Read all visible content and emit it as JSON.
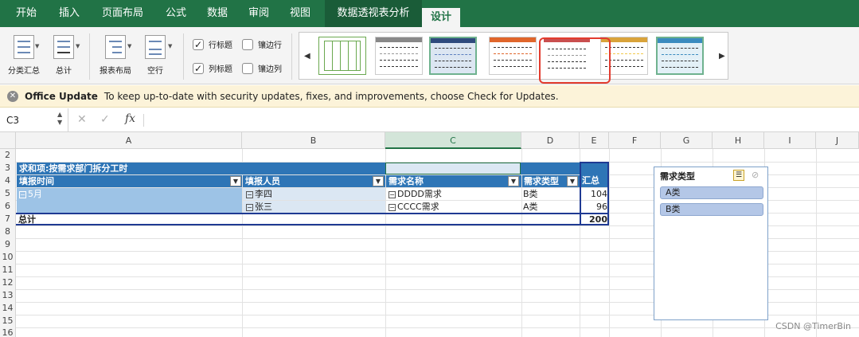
{
  "tabs": [
    "开始",
    "插入",
    "页面布局",
    "公式",
    "数据",
    "审阅",
    "视图",
    "数据透视表分析",
    "设计"
  ],
  "ribbon": {
    "subtotal_label": "分类汇总",
    "grandtotal_label": "总计",
    "report_layout_label": "报表布局",
    "blank_rows_label": "空行",
    "row_headers_label": "行标题",
    "col_headers_label": "列标题",
    "banded_rows_label": "镶边行",
    "banded_cols_label": "镶边列"
  },
  "message_bar": {
    "title": "Office Update",
    "text": "To keep up-to-date with security updates, fixes, and improvements, choose Check for Updates."
  },
  "formula_bar": {
    "name_box": "C3",
    "fx": "fx"
  },
  "columns": [
    "A",
    "B",
    "C",
    "D",
    "E",
    "F",
    "G",
    "H",
    "I",
    "J"
  ],
  "rows": [
    "2",
    "3",
    "4",
    "5",
    "6",
    "7",
    "8",
    "9",
    "10",
    "11",
    "12",
    "13",
    "14",
    "15",
    "16"
  ],
  "pivot": {
    "title": "求和项:按需求部门拆分工时",
    "headers": [
      "填报时间",
      "填报人员",
      "需求名称",
      "需求类型",
      "汇总"
    ],
    "month": "5月",
    "people": [
      "李四",
      "张三"
    ],
    "names": [
      "DDDD需求",
      "CCCC需求"
    ],
    "types": [
      "B类",
      "A类"
    ],
    "values": [
      "104",
      "96"
    ],
    "total_label": "总计",
    "total_value": "200"
  },
  "slicer": {
    "title": "需求类型",
    "items": [
      "A类",
      "B类"
    ]
  },
  "watermark": "CSDN @TimerBin",
  "colors": {
    "excel_green": "#217346",
    "pivot_header": "#2e75b6",
    "highlight": "#e23b2e"
  }
}
